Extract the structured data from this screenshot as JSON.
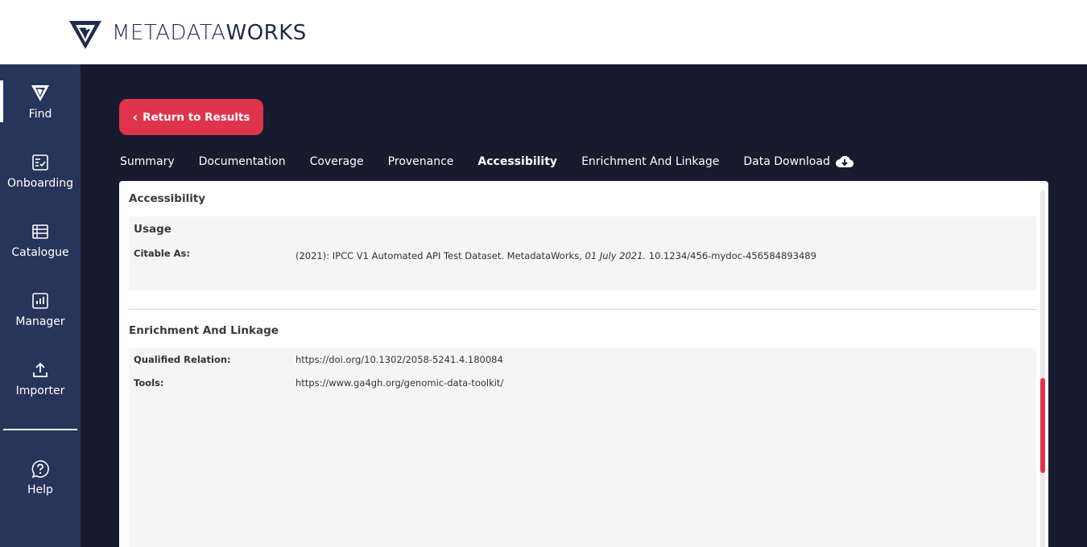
{
  "brand": {
    "name_light": "METADATA",
    "name_bold": "WORKS"
  },
  "sidebar": {
    "items": [
      {
        "label": "Find",
        "icon": "find-icon"
      },
      {
        "label": "Onboarding",
        "icon": "onboarding-icon"
      },
      {
        "label": "Catalogue",
        "icon": "catalogue-icon"
      },
      {
        "label": "Manager",
        "icon": "manager-icon"
      },
      {
        "label": "Importer",
        "icon": "importer-icon"
      },
      {
        "label": "Help",
        "icon": "help-icon"
      }
    ]
  },
  "main": {
    "return_label": "Return to Results",
    "tabs": [
      {
        "label": "Summary"
      },
      {
        "label": "Documentation"
      },
      {
        "label": "Coverage"
      },
      {
        "label": "Provenance"
      },
      {
        "label": "Accessibility"
      },
      {
        "label": "Enrichment And Linkage"
      },
      {
        "label": "Data Download"
      }
    ],
    "active_tab": "Accessibility"
  },
  "panel": {
    "accessibility": {
      "title": "Accessibility",
      "usage_title": "Usage",
      "citable_label": "Citable As:",
      "citable_prefix": "(2021): IPCC V1 Automated API Test Dataset. MetadataWorks,",
      "citable_date": "01 July 2021.",
      "citable_suffix": "10.1234/456-mydoc-456584893489"
    },
    "enrichment": {
      "title": "Enrichment And Linkage",
      "qualified_relation_label": "Qualified Relation:",
      "qualified_relation_value": "https://doi.org/10.1302/2058-5241.4.180084",
      "tools_label": "Tools:",
      "tools_value": "https://www.ga4gh.org/genomic-data-toolkit/"
    }
  },
  "colors": {
    "accent": "#e0344d",
    "sidebar": "#28355a",
    "background": "#161b2e",
    "brand": "#1f2a4d"
  }
}
